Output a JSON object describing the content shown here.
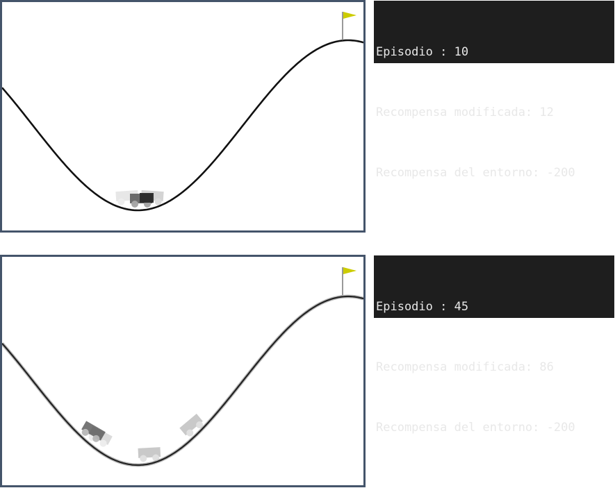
{
  "episodes": [
    {
      "episode_label": "Episodio : 10",
      "modified_reward_label": "Recompensa modificada: 12",
      "env_reward_label": "Recompensa del entorno: -200"
    },
    {
      "episode_label": "Episodio : 45",
      "modified_reward_label": "Recompensa modificada: 86",
      "env_reward_label": "Recompensa del entorno: -200"
    }
  ],
  "colors": {
    "frame_border": "#44546a",
    "console_bg": "#1e1e1e",
    "console_text": "#e8e8e8",
    "track": "#111111",
    "flag": "#cccc00",
    "car_dark": "#333333",
    "car_mid": "#777777",
    "car_light": "#bbbbbb"
  },
  "icons": {
    "goal": "flag-icon",
    "agent": "car-icon"
  }
}
